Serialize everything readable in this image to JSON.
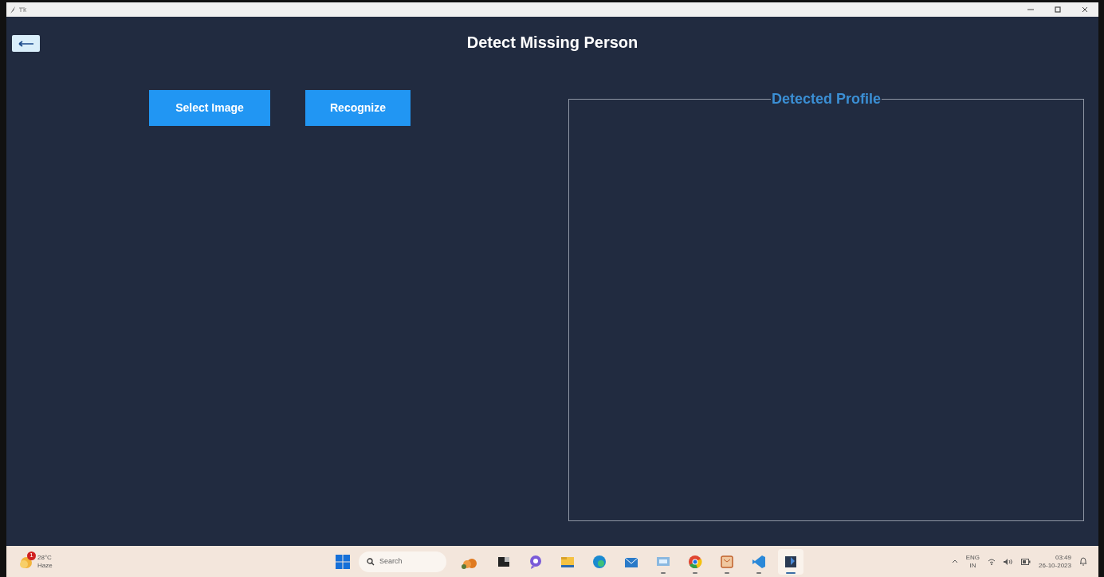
{
  "header": {
    "title": "Detect Missing Person"
  },
  "actions": [
    {
      "label": "Select Image"
    },
    {
      "label": "Recognize"
    }
  ],
  "profile_panel": {
    "title": "Detected Profile"
  },
  "taskbar": {
    "weather": {
      "badge": "1",
      "temperature": "28°C",
      "condition": "Haze"
    },
    "search": {
      "placeholder": "Search"
    },
    "apps": [
      {
        "kind": "widget",
        "running": false
      },
      {
        "kind": "terminal",
        "running": false
      },
      {
        "kind": "chat",
        "running": false
      },
      {
        "kind": "folder",
        "running": false
      },
      {
        "kind": "edge",
        "running": false
      },
      {
        "kind": "mail",
        "running": false
      },
      {
        "kind": "monitor",
        "running": true
      },
      {
        "kind": "chrome",
        "running": true
      },
      {
        "kind": "tool",
        "running": true
      },
      {
        "kind": "code",
        "running": true
      },
      {
        "kind": "python",
        "running": true,
        "selected": true
      }
    ],
    "language": "ENG",
    "region": "IN",
    "time": "03:49",
    "date": "26-10-2023"
  }
}
